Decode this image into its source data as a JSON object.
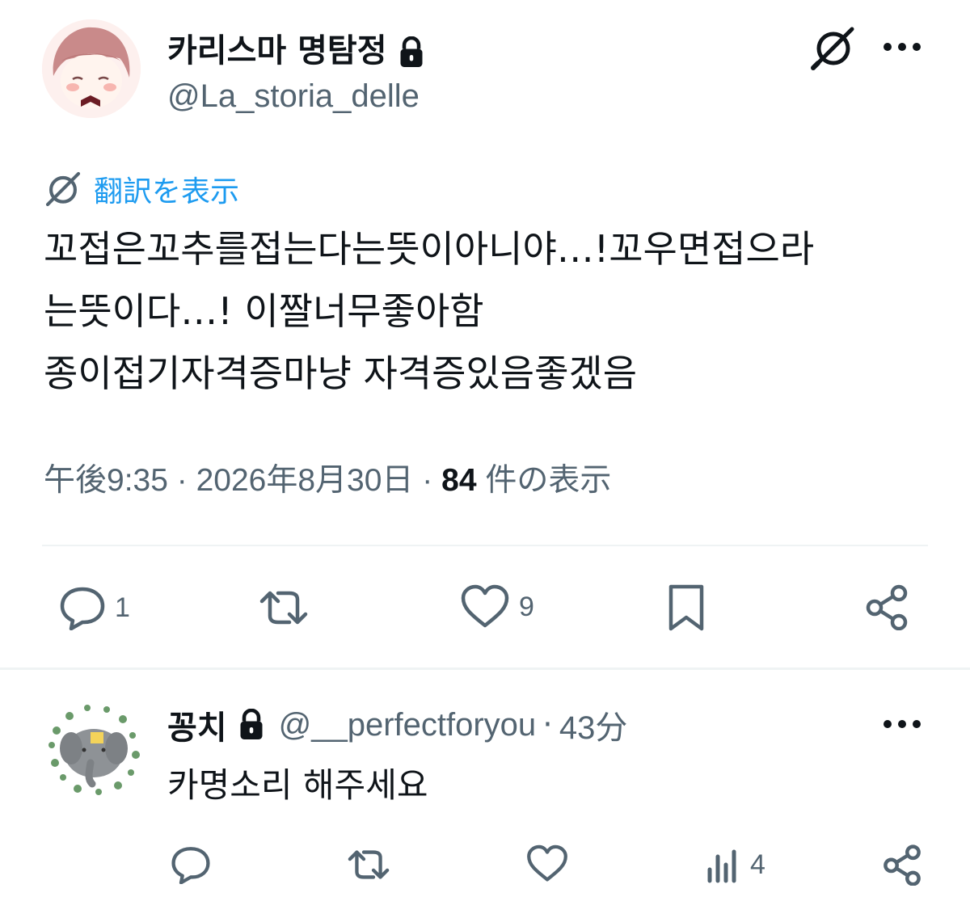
{
  "tweet": {
    "author": {
      "display_name": "카리스마 명탐정",
      "handle": "@La_storia_delle",
      "protected": true
    },
    "translate_label": "翻訳を表示",
    "text_lines": [
      "꼬접은꼬추를접는다는뜻이아니야…!꼬우면접으라",
      "는뜻이다…! 이짤너무좋아함",
      "종이접기자격증마냥 자격증있음좋겠음"
    ],
    "time": "午後9:35",
    "date": "2026年8月30日",
    "views_count": "84",
    "views_label": "件の表示",
    "separator": "·",
    "actions": {
      "reply_count": "1",
      "retweet_count": "",
      "like_count": "9"
    }
  },
  "reply": {
    "display_name": "꽁치",
    "handle": "@__perfectforyou",
    "separator": "·",
    "time": "43分",
    "protected": true,
    "text": "카명소리 해주세요",
    "actions": {
      "views_count": "4"
    }
  },
  "colors": {
    "text_primary": "#0f1419",
    "text_secondary": "#536471",
    "accent": "#1d9bf0",
    "divider": "#eff3f4"
  },
  "icons": [
    "lock-icon",
    "grok-icon",
    "more-icon",
    "translate-icon",
    "reply-icon",
    "retweet-icon",
    "like-icon",
    "bookmark-icon",
    "share-icon",
    "views-icon"
  ]
}
